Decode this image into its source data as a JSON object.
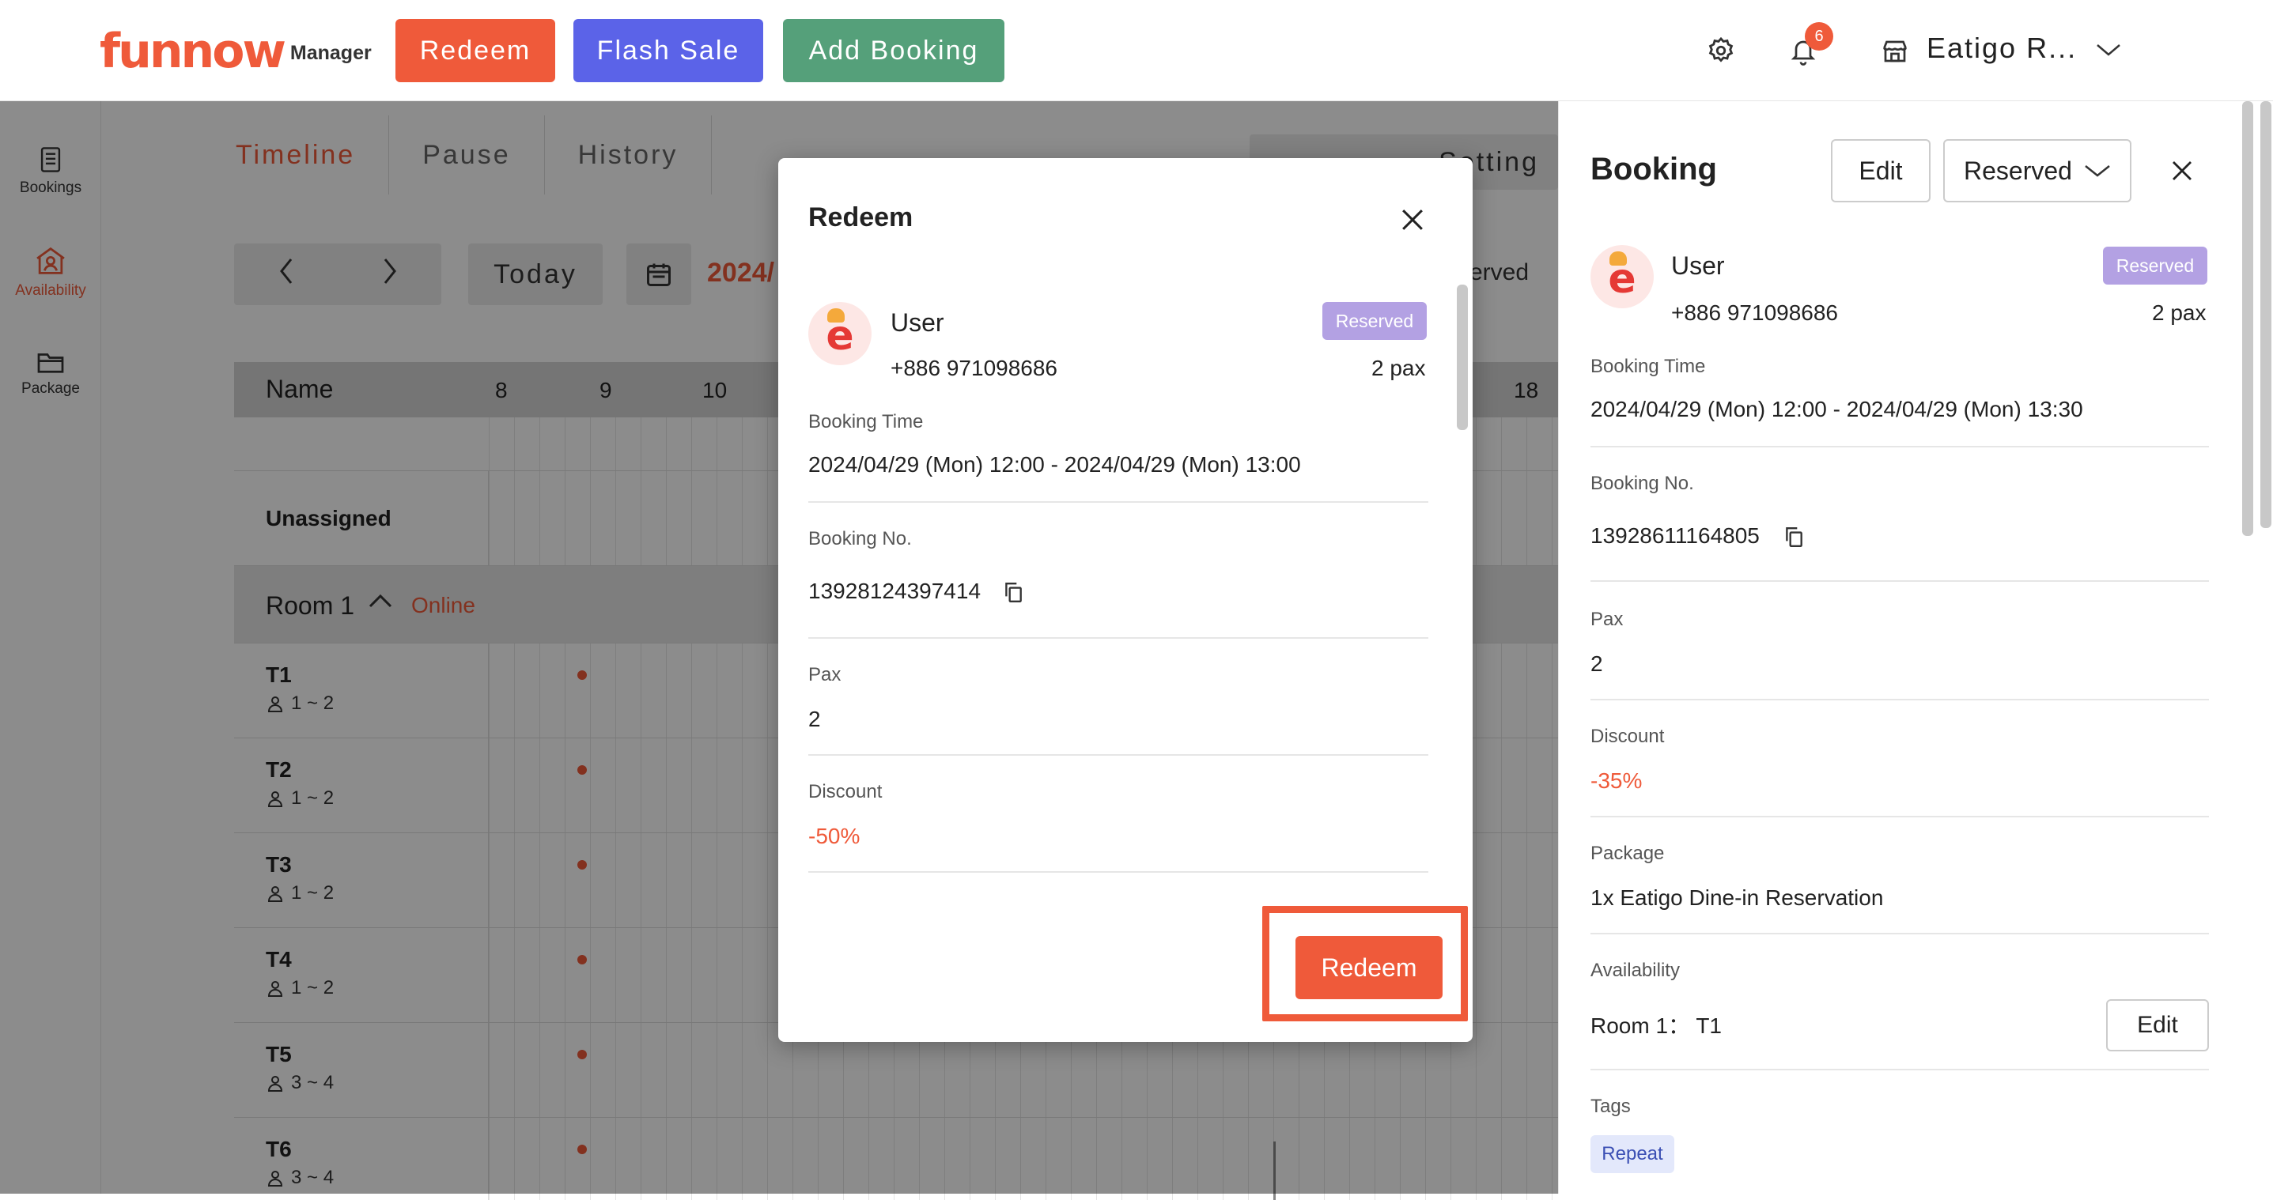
{
  "header": {
    "brand": "funnow",
    "brand_suffix": "Manager",
    "buttons": {
      "redeem": "Redeem",
      "flash_sale": "Flash Sale",
      "add_booking": "Add Booking"
    },
    "colors": {
      "redeem": "#ef5a3a",
      "flash_sale": "#5b63e8",
      "add_booking": "#55a07a"
    },
    "notification_count": "6",
    "store_name": "Eatigo R..."
  },
  "sidebar": {
    "items": [
      {
        "label": "Bookings",
        "icon": "document-icon"
      },
      {
        "label": "Availability",
        "icon": "store-user-icon"
      },
      {
        "label": "Package",
        "icon": "folder-icon"
      }
    ]
  },
  "timeline": {
    "tabs": [
      "Timeline",
      "Pause",
      "History"
    ],
    "setting_label": "Setting",
    "today_label": "Today",
    "date_partial": "2024/",
    "legend_partial": "erved",
    "name_header": "Name",
    "hours": [
      "8",
      "9",
      "10",
      "18"
    ],
    "unassigned_label": "Unassigned",
    "room_label": "Room 1",
    "room_status": "Online",
    "tables": [
      {
        "name": "T1",
        "capacity": "1 ~ 2"
      },
      {
        "name": "T2",
        "capacity": "1 ~ 2"
      },
      {
        "name": "T3",
        "capacity": "1 ~ 2"
      },
      {
        "name": "T4",
        "capacity": "1 ~ 2"
      },
      {
        "name": "T5",
        "capacity": "3 ~ 4"
      },
      {
        "name": "T6",
        "capacity": "3 ~ 4"
      }
    ]
  },
  "modal": {
    "title": "Redeem",
    "user_name": "User",
    "status": "Reserved",
    "phone": "+886 971098686",
    "pax_summary": "2 pax",
    "booking_time_label": "Booking Time",
    "booking_time": "2024/04/29 (Mon) 12:00 - 2024/04/29 (Mon) 13:00",
    "booking_no_label": "Booking No.",
    "booking_no": "13928124397414",
    "pax_label": "Pax",
    "pax": "2",
    "discount_label": "Discount",
    "discount": "-50%",
    "redeem_button": "Redeem"
  },
  "panel": {
    "title": "Booking",
    "edit_label": "Edit",
    "status_select": "Reserved",
    "user_name": "User",
    "status": "Reserved",
    "phone": "+886 971098686",
    "pax_summary": "2 pax",
    "booking_time_label": "Booking Time",
    "booking_time": "2024/04/29 (Mon) 12:00 - 2024/04/29 (Mon) 13:30",
    "booking_no_label": "Booking No.",
    "booking_no": "13928611164805",
    "pax_label": "Pax",
    "pax": "2",
    "discount_label": "Discount",
    "discount": "-35%",
    "package_label": "Package",
    "package": "1x Eatigo Dine-in Reservation",
    "availability_label": "Availability",
    "availability": "Room 1： T1",
    "availability_edit": "Edit",
    "tags_label": "Tags",
    "tags": [
      "Repeat"
    ]
  }
}
